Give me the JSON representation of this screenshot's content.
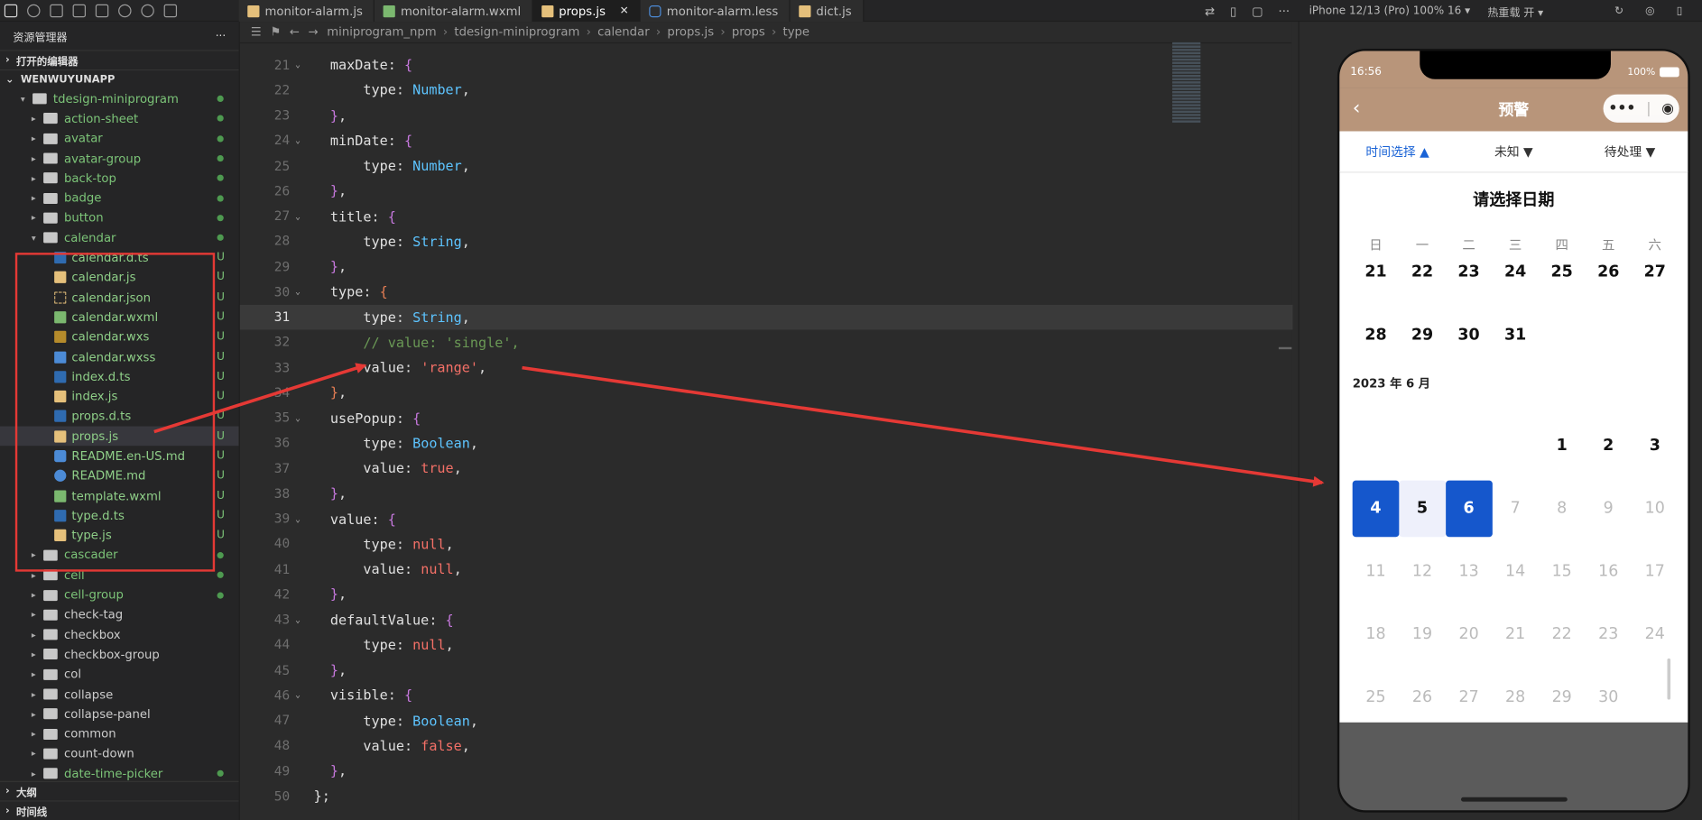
{
  "tabs": [
    {
      "label": "monitor-alarm.js",
      "icon": "js",
      "active": false
    },
    {
      "label": "monitor-alarm.wxml",
      "icon": "wx",
      "active": false
    },
    {
      "label": "props.js",
      "icon": "js",
      "active": true
    },
    {
      "label": "monitor-alarm.less",
      "icon": "less",
      "active": false
    },
    {
      "label": "dict.js",
      "icon": "js",
      "active": false
    }
  ],
  "tab_close": "✕",
  "simulator": {
    "device": "iPhone 12/13 (Pro) 100% 16 ▾",
    "hot_reload": "热重载 开 ▾"
  },
  "explorer": {
    "header": "资源管理器",
    "more": "···",
    "open_editors": "打开的编辑器",
    "project": "WENWUYUNAPP",
    "items": [
      {
        "label": "tdesign-miniprogram",
        "kind": "folder-open",
        "depth": 1,
        "git": "dot"
      },
      {
        "label": "action-sheet",
        "kind": "folder",
        "depth": 2,
        "git": "dot"
      },
      {
        "label": "avatar",
        "kind": "folder",
        "depth": 2,
        "git": "dot"
      },
      {
        "label": "avatar-group",
        "kind": "folder",
        "depth": 2,
        "git": "dot"
      },
      {
        "label": "back-top",
        "kind": "folder",
        "depth": 2,
        "git": "dot"
      },
      {
        "label": "badge",
        "kind": "folder",
        "depth": 2,
        "git": "dot"
      },
      {
        "label": "button",
        "kind": "folder",
        "depth": 2,
        "git": "dot"
      },
      {
        "label": "calendar",
        "kind": "folder-open",
        "depth": 2,
        "git": "dot"
      },
      {
        "label": "calendar.d.ts",
        "kind": "ts",
        "depth": 3,
        "git": "U"
      },
      {
        "label": "calendar.js",
        "kind": "js",
        "depth": 3,
        "git": "U"
      },
      {
        "label": "calendar.json",
        "kind": "json",
        "depth": 3,
        "git": "U"
      },
      {
        "label": "calendar.wxml",
        "kind": "wx",
        "depth": 3,
        "git": "U"
      },
      {
        "label": "calendar.wxs",
        "kind": "wxs",
        "depth": 3,
        "git": "U"
      },
      {
        "label": "calendar.wxss",
        "kind": "css",
        "depth": 3,
        "git": "U"
      },
      {
        "label": "index.d.ts",
        "kind": "ts",
        "depth": 3,
        "git": "U"
      },
      {
        "label": "index.js",
        "kind": "js",
        "depth": 3,
        "git": "U"
      },
      {
        "label": "props.d.ts",
        "kind": "ts",
        "depth": 3,
        "git": "U"
      },
      {
        "label": "props.js",
        "kind": "js",
        "depth": 3,
        "git": "U",
        "selected": true
      },
      {
        "label": "README.en-US.md",
        "kind": "md",
        "depth": 3,
        "git": "U"
      },
      {
        "label": "README.md",
        "kind": "info",
        "depth": 3,
        "git": "U"
      },
      {
        "label": "template.wxml",
        "kind": "wx",
        "depth": 3,
        "git": "U"
      },
      {
        "label": "type.d.ts",
        "kind": "ts",
        "depth": 3,
        "git": "U"
      },
      {
        "label": "type.js",
        "kind": "js",
        "depth": 3,
        "git": "U"
      },
      {
        "label": "cascader",
        "kind": "folder",
        "depth": 2,
        "git": "dot"
      },
      {
        "label": "cell",
        "kind": "folder",
        "depth": 2,
        "git": "dot"
      },
      {
        "label": "cell-group",
        "kind": "folder",
        "depth": 2,
        "git": "dot"
      },
      {
        "label": "check-tag",
        "kind": "folder",
        "depth": 2,
        "git": ""
      },
      {
        "label": "checkbox",
        "kind": "folder",
        "depth": 2,
        "git": ""
      },
      {
        "label": "checkbox-group",
        "kind": "folder",
        "depth": 2,
        "git": ""
      },
      {
        "label": "col",
        "kind": "folder",
        "depth": 2,
        "git": ""
      },
      {
        "label": "collapse",
        "kind": "folder",
        "depth": 2,
        "git": ""
      },
      {
        "label": "collapse-panel",
        "kind": "folder",
        "depth": 2,
        "git": ""
      },
      {
        "label": "common",
        "kind": "folder",
        "depth": 2,
        "git": ""
      },
      {
        "label": "count-down",
        "kind": "folder",
        "depth": 2,
        "git": ""
      },
      {
        "label": "date-time-picker",
        "kind": "folder",
        "depth": 2,
        "git": "dot"
      }
    ],
    "outline": "大纲",
    "timeline": "时间线"
  },
  "breadcrumb": [
    "miniprogram_npm",
    "tdesign-miniprogram",
    "calendar",
    "props.js",
    "props",
    "type"
  ],
  "code": [
    {
      "n": 21,
      "html": "  <span class='k'>maxDate</span>: <span class='p'>{</span>",
      "fold": true
    },
    {
      "n": 22,
      "html": "      <span class='k'>type</span>: <span class='ty'>Number</span>,"
    },
    {
      "n": 23,
      "html": "  <span class='p'>}</span>,"
    },
    {
      "n": 24,
      "html": "  <span class='k'>minDate</span>: <span class='p'>{</span>",
      "fold": true
    },
    {
      "n": 25,
      "html": "      <span class='k'>type</span>: <span class='ty'>Number</span>,"
    },
    {
      "n": 26,
      "html": "  <span class='p'>}</span>,"
    },
    {
      "n": 27,
      "html": "  <span class='k'>title</span>: <span class='p'>{</span>",
      "fold": true
    },
    {
      "n": 28,
      "html": "      <span class='k'>type</span>: <span class='ty'>String</span>,"
    },
    {
      "n": 29,
      "html": "  <span class='p'>}</span>,"
    },
    {
      "n": 30,
      "html": "  <span class='k'>type</span>: <span class='b'>{</span>",
      "fold": true
    },
    {
      "n": 31,
      "html": "      <span class='k'>type</span>: <span class='ty'>String</span>,",
      "current": true
    },
    {
      "n": 32,
      "html": "      <span class='c'>// value: 'single',</span>"
    },
    {
      "n": 33,
      "html": "      <span class='k'>value</span>: <span class='s'>'range'</span>,"
    },
    {
      "n": 34,
      "html": "  <span class='b'>}</span>,"
    },
    {
      "n": 35,
      "html": "  <span class='k'>usePopup</span>: <span class='p'>{</span>",
      "fold": true
    },
    {
      "n": 36,
      "html": "      <span class='k'>type</span>: <span class='ty'>Boolean</span>,"
    },
    {
      "n": 37,
      "html": "      <span class='k'>value</span>: <span class='s'>true</span>,"
    },
    {
      "n": 38,
      "html": "  <span class='p'>}</span>,"
    },
    {
      "n": 39,
      "html": "  <span class='k'>value</span>: <span class='p'>{</span>",
      "fold": true
    },
    {
      "n": 40,
      "html": "      <span class='k'>type</span>: <span class='s'>null</span>,"
    },
    {
      "n": 41,
      "html": "      <span class='k'>value</span>: <span class='s'>null</span>,"
    },
    {
      "n": 42,
      "html": "  <span class='p'>}</span>,"
    },
    {
      "n": 43,
      "html": "  <span class='k'>defaultValue</span>: <span class='p'>{</span>",
      "fold": true
    },
    {
      "n": 44,
      "html": "      <span class='k'>type</span>: <span class='s'>null</span>,"
    },
    {
      "n": 45,
      "html": "  <span class='p'>}</span>,"
    },
    {
      "n": 46,
      "html": "  <span class='k'>visible</span>: <span class='p'>{</span>",
      "fold": true
    },
    {
      "n": 47,
      "html": "      <span class='k'>type</span>: <span class='ty'>Boolean</span>,"
    },
    {
      "n": 48,
      "html": "      <span class='k'>value</span>: <span class='s'>false</span>,"
    },
    {
      "n": 49,
      "html": "  <span class='p'>}</span>,"
    },
    {
      "n": 50,
      "html": "<span class='k'>}</span>;"
    }
  ],
  "phone": {
    "time": "16:56",
    "battery": "100%",
    "title": "预警",
    "back": "‹",
    "capsule_more": "•••",
    "capsule_close": "◉",
    "filters": [
      {
        "label": "时间选择 ▲",
        "active": true
      },
      {
        "label": "未知 ▼",
        "active": false
      },
      {
        "label": "待处理 ▼",
        "active": false
      }
    ],
    "calendar": {
      "title": "请选择日期",
      "weekdays": [
        "日",
        "一",
        "二",
        "三",
        "四",
        "五",
        "六"
      ],
      "row_prev": [
        [
          "21",
          ""
        ],
        [
          "22",
          ""
        ],
        [
          "23",
          ""
        ],
        [
          "24",
          ""
        ],
        [
          "25",
          ""
        ],
        [
          "26",
          ""
        ],
        [
          "27",
          ""
        ]
      ],
      "row_may_end": [
        [
          "28",
          ""
        ],
        [
          "29",
          ""
        ],
        [
          "30",
          ""
        ],
        [
          "31",
          ""
        ],
        [
          "",
          ""
        ],
        [
          "",
          ""
        ],
        [
          "",
          ""
        ]
      ],
      "month_label": "2023 年 6 月",
      "weeks": [
        [
          [
            "",
            ""
          ],
          [
            "",
            ""
          ],
          [
            "",
            ""
          ],
          [
            "",
            ""
          ],
          [
            "1",
            ""
          ],
          [
            "2",
            ""
          ],
          [
            "3",
            ""
          ]
        ],
        [
          [
            "4",
            "sel"
          ],
          [
            "5",
            "mid"
          ],
          [
            "6",
            "sel"
          ],
          [
            "7",
            "dim"
          ],
          [
            "8",
            "dim"
          ],
          [
            "9",
            "dim"
          ],
          [
            "10",
            "dim"
          ]
        ],
        [
          [
            "11",
            "dim"
          ],
          [
            "12",
            "dim"
          ],
          [
            "13",
            "dim"
          ],
          [
            "14",
            "dim"
          ],
          [
            "15",
            "dim"
          ],
          [
            "16",
            "dim"
          ],
          [
            "17",
            "dim"
          ]
        ],
        [
          [
            "18",
            "dim"
          ],
          [
            "19",
            "dim"
          ],
          [
            "20",
            "dim"
          ],
          [
            "21",
            "dim"
          ],
          [
            "22",
            "dim"
          ],
          [
            "23",
            "dim"
          ],
          [
            "24",
            "dim"
          ]
        ],
        [
          [
            "25",
            "dim"
          ],
          [
            "26",
            "dim"
          ],
          [
            "27",
            "dim"
          ],
          [
            "28",
            "dim"
          ],
          [
            "29",
            "dim"
          ],
          [
            "30",
            "dim"
          ],
          [
            "",
            ""
          ]
        ]
      ]
    }
  },
  "colors": {
    "arrow": "#e53935",
    "accent": "#1557cc",
    "navbar": "#b8957a"
  }
}
